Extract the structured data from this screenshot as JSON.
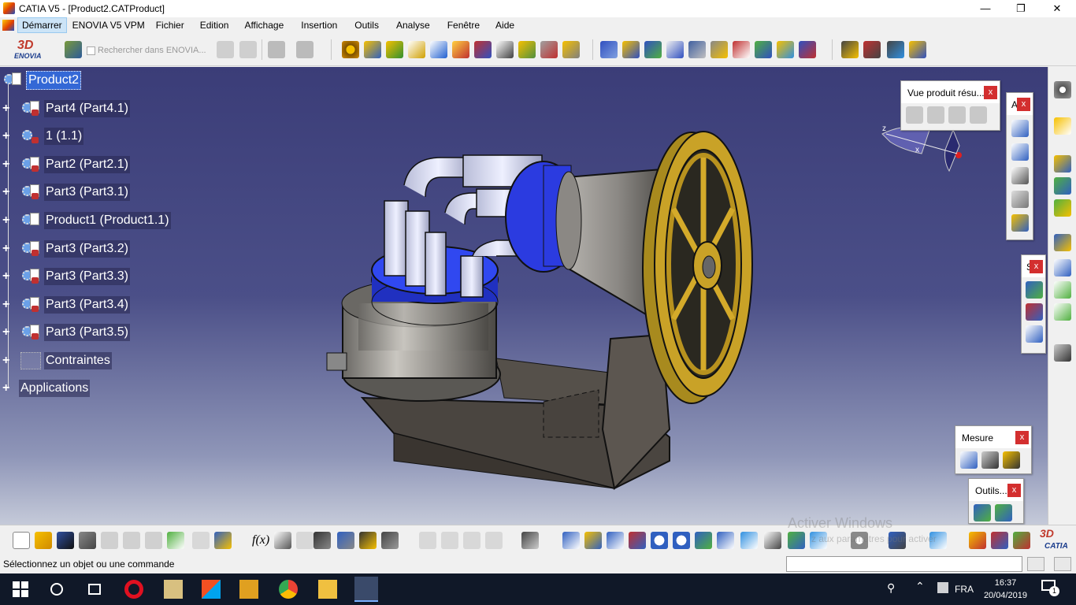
{
  "window": {
    "title": "CATIA V5 - [Product2.CATProduct]"
  },
  "menubar": {
    "items": [
      "Démarrer",
      "ENOVIA V5 VPM",
      "Fichier",
      "Edition",
      "Affichage",
      "Insertion",
      "Outils",
      "Analyse",
      "Fenêtre",
      "Aide"
    ]
  },
  "toolbar": {
    "brand": "ENOVIA",
    "search_label": "Rechercher dans ENOVIA..."
  },
  "tree": {
    "root": "Product2",
    "nodes": [
      "Part4 (Part4.1)",
      "1 (1.1)",
      "Part2 (Part2.1)",
      "Part3 (Part3.1)",
      "Product1 (Product1.1)",
      "Part3 (Part3.2)",
      "Part3 (Part3.3)",
      "Part3 (Part3.4)",
      "Part3 (Part3.5)",
      "Contraintes",
      "Applications"
    ]
  },
  "compass": {
    "z": "z",
    "x": "x"
  },
  "panels": {
    "vue": {
      "title": "Vue produit résu...",
      "close": "x"
    },
    "a": {
      "title": "A",
      "close": "x"
    },
    "s": {
      "title": "S",
      "close": "x"
    },
    "mesure": {
      "title": "Mesure",
      "close": "x"
    },
    "outils": {
      "title": "Outils...",
      "close": "x"
    }
  },
  "status": {
    "message": "Sélectionnez un objet ou une commande"
  },
  "watermark": {
    "line1": "Activer Windows",
    "line2": "z aux paramètres pour activer"
  },
  "bottombar": {
    "fx": "f(x)"
  },
  "brand_bottom": "CATIA",
  "taskbar": {
    "lang": "FRA",
    "time": "16:37",
    "date": "20/04/2019",
    "notif_count": "1"
  },
  "colors": {
    "viewport_top": "#3b3d78",
    "selection": "#3468d6",
    "close_button": "#d32f2f",
    "flywheel": "#c9a227",
    "cylinder_blue": "#2b3be0"
  }
}
